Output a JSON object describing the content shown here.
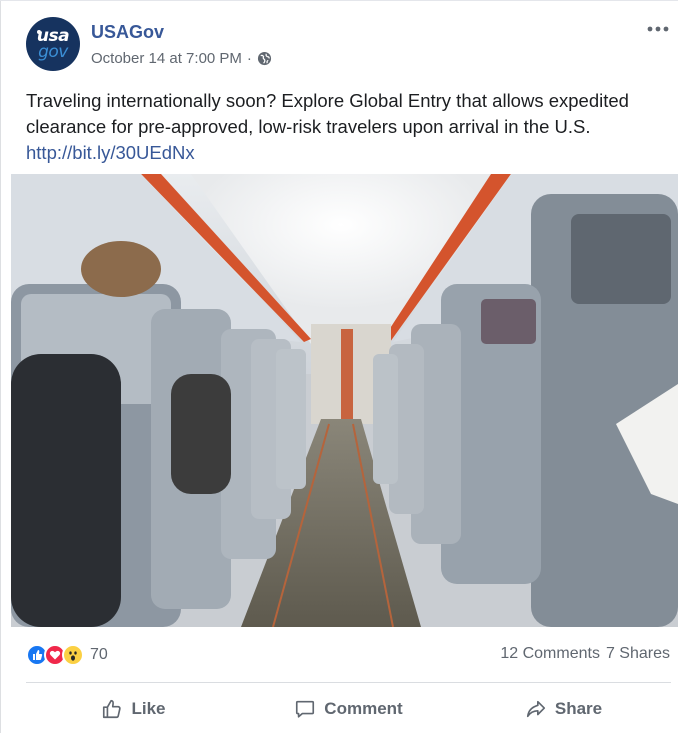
{
  "post": {
    "page_name": "USAGov",
    "timestamp": "October 14 at 7:00 PM",
    "meta_separator": "·",
    "text": "Traveling internationally soon? Explore Global Entry that allows expedited clearance for pre-approved, low-risk travelers upon arrival in the U.S.",
    "link": "http://bit.ly/30UEdNx",
    "avatar": {
      "line1": "usa",
      "line2": "gov"
    },
    "photo_icon": "airplane-cabin-photo",
    "privacy_icon": "globe-icon"
  },
  "engagement": {
    "reaction_icons": [
      "like-reaction-icon",
      "love-reaction-icon",
      "wow-reaction-icon"
    ],
    "reaction_count": "70",
    "comments": "12 Comments",
    "shares": "7 Shares"
  },
  "actions": {
    "like": "Like",
    "comment": "Comment",
    "share": "Share"
  },
  "colors": {
    "link_blue": "#385898",
    "meta_gray": "#606770",
    "like_blue": "#1877f2",
    "love_red": "#f0284a",
    "wow_yellow": "#fbd043"
  }
}
